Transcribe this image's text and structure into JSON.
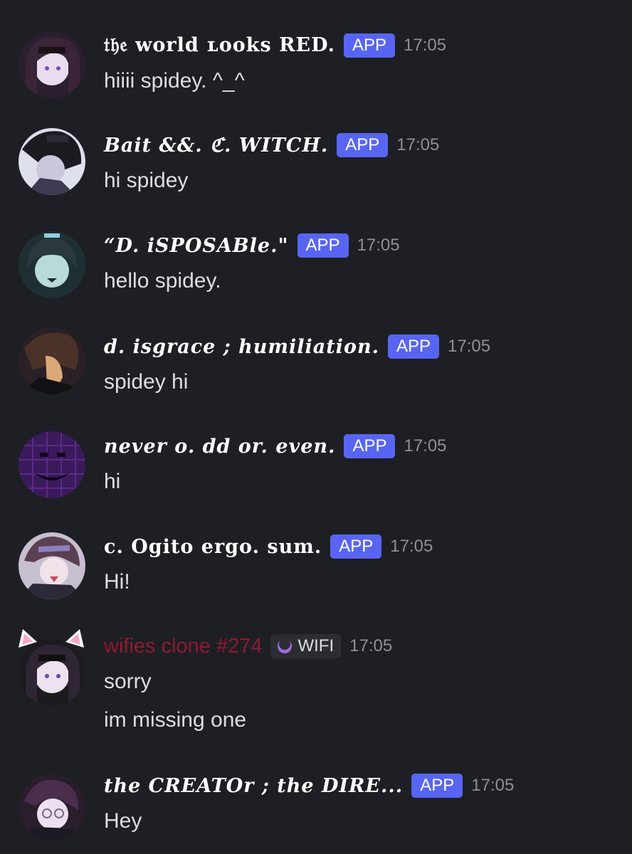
{
  "colors": {
    "background": "#1e1f24",
    "app_tag": "#5865f2",
    "wifi_tag_bg": "#2b2d33",
    "username_plain": "#8f1a30",
    "timestamp": "#8e9099",
    "message_text": "#dcdee3"
  },
  "messages": [
    {
      "username": "𝔱𝔥𝔢 world ʟoᴏks RED.",
      "tag": "APP",
      "time": "17:05",
      "lines": [
        "hiiii spidey. ^_^"
      ],
      "avatar_icon": "avatar-purple-hair"
    },
    {
      "username": "Bait  &&.  ℭ. WITCH.",
      "tag": "APP",
      "time": "17:05",
      "lines": [
        "hi spidey"
      ],
      "avatar_icon": "avatar-dark-hair-glasses"
    },
    {
      "username": "“D. iSPOSABle.\"",
      "tag": "APP",
      "time": "17:05",
      "lines": [
        "hello spidey."
      ],
      "avatar_icon": "avatar-teal-face"
    },
    {
      "username": "d.  isgrace ;  humiliation.",
      "tag": "APP",
      "time": "17:05",
      "lines": [
        "spidey hi"
      ],
      "avatar_icon": "avatar-brown-hair"
    },
    {
      "username": "never  o. dd  or.  even.",
      "tag": "APP",
      "time": "17:05",
      "lines": [
        "hi"
      ],
      "avatar_icon": "avatar-purple-grid"
    },
    {
      "username": "c. Ogito  ergo.  sum.",
      "tag": "APP",
      "time": "17:05",
      "lines": [
        "Hi!"
      ],
      "avatar_icon": "avatar-purple-blush"
    },
    {
      "username": "wifies clone #274",
      "tag": "WIFI",
      "tag_icon": "moon-icon",
      "time": "17:05",
      "lines": [
        "sorry",
        "im missing one"
      ],
      "avatar_icon": "avatar-cat-ears"
    },
    {
      "username": "the  CREATOr ;  the  DIRE...",
      "tag": "APP",
      "time": "17:05",
      "lines": [
        "Hey"
      ],
      "avatar_icon": "avatar-purple-glasses"
    }
  ]
}
